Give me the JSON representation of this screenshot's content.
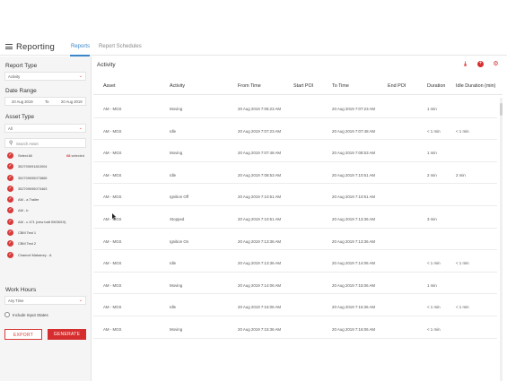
{
  "header": {
    "app_title": "Reporting",
    "tabs": [
      {
        "label": "Reports",
        "active": true
      },
      {
        "label": "Report Schedules",
        "active": false
      }
    ],
    "accent_color": "#3a86c8"
  },
  "sidebar": {
    "report_type_label": "Report Type",
    "report_type_value": "Activity",
    "date_range_label": "Date Range",
    "date_from": "20 Aug 2019",
    "date_sep": "To",
    "date_to": "20 Aug 2019",
    "asset_type_label": "Asset Type",
    "asset_type_value": "All",
    "search_placeholder": "Search Asset",
    "assets": [
      {
        "name": "Select All",
        "checked": true
      },
      {
        "name": "352709091810004",
        "checked": true
      },
      {
        "name": "352709095073865",
        "checked": true
      },
      {
        "name": "352709095073463",
        "checked": true
      },
      {
        "name": "AM - a Trailer",
        "checked": true
      },
      {
        "name": "AM - b",
        "checked": true
      },
      {
        "name": "AM - c 471 (new batt 09/08/19)",
        "checked": true
      },
      {
        "name": "CBM Test 1",
        "checked": true
      },
      {
        "name": "CBM Test 2",
        "checked": true
      },
      {
        "name": "Channel Mahaney - A",
        "checked": true
      }
    ],
    "selected_count": "68",
    "selected_suffix": "selected",
    "work_hours_label": "Work Hours",
    "work_hours_value": "Any Time",
    "include_input_states_label": "Include Input States",
    "export_label": "EXPORT",
    "generate_label": "GENERATE",
    "accent_color": "#d62e2e"
  },
  "main": {
    "title": "Activity",
    "columns": [
      "Asset",
      "Activity",
      "From Time",
      "Start POI",
      "To Time",
      "End POI",
      "Duration",
      "Idle Duration (min)"
    ],
    "rows": [
      [
        "AM - MGS",
        "Moving",
        "20 Aug 2019 7:06:23 AM",
        "",
        "20 Aug 2019 7:07:23 AM",
        "",
        "1 min",
        ""
      ],
      [
        "AM - MGS",
        "Idle",
        "20 Aug 2019 7:07:23 AM",
        "",
        "20 Aug 2019 7:07:48 AM",
        "",
        "< 1 min",
        "< 1 min"
      ],
      [
        "AM - MGS",
        "Moving",
        "20 Aug 2019 7:07:48 AM",
        "",
        "20 Aug 2019 7:08:53 AM",
        "",
        "1 min",
        ""
      ],
      [
        "AM - MGS",
        "Idle",
        "20 Aug 2019 7:08:53 AM",
        "",
        "20 Aug 2019 7:10:51 AM",
        "",
        "2 min",
        "2 min"
      ],
      [
        "AM - MGS",
        "Ignition Off",
        "20 Aug 2019 7:10:51 AM",
        "",
        "20 Aug 2019 7:10:51 AM",
        "",
        "",
        ""
      ],
      [
        "AM - MGS",
        "Stopped",
        "20 Aug 2019 7:10:51 AM",
        "",
        "20 Aug 2019 7:13:36 AM",
        "",
        "3 min",
        ""
      ],
      [
        "AM - MGS",
        "Ignition On",
        "20 Aug 2019 7:13:36 AM",
        "",
        "20 Aug 2019 7:13:36 AM",
        "",
        "",
        ""
      ],
      [
        "AM - MGS",
        "Idle",
        "20 Aug 2019 7:13:36 AM",
        "",
        "20 Aug 2019 7:14:06 AM",
        "",
        "< 1 min",
        "< 1 min"
      ],
      [
        "AM - MGS",
        "Moving",
        "20 Aug 2019 7:14:06 AM",
        "",
        "20 Aug 2019 7:15:06 AM",
        "",
        "1 min",
        ""
      ],
      [
        "AM - MGS",
        "Idle",
        "20 Aug 2019 7:15:06 AM",
        "",
        "20 Aug 2019 7:15:36 AM",
        "",
        "< 1 min",
        "< 1 min"
      ],
      [
        "AM - MGS",
        "Moving",
        "20 Aug 2019 7:15:36 AM",
        "",
        "20 Aug 2019 7:16:06 AM",
        "",
        "< 1 min",
        ""
      ]
    ]
  }
}
